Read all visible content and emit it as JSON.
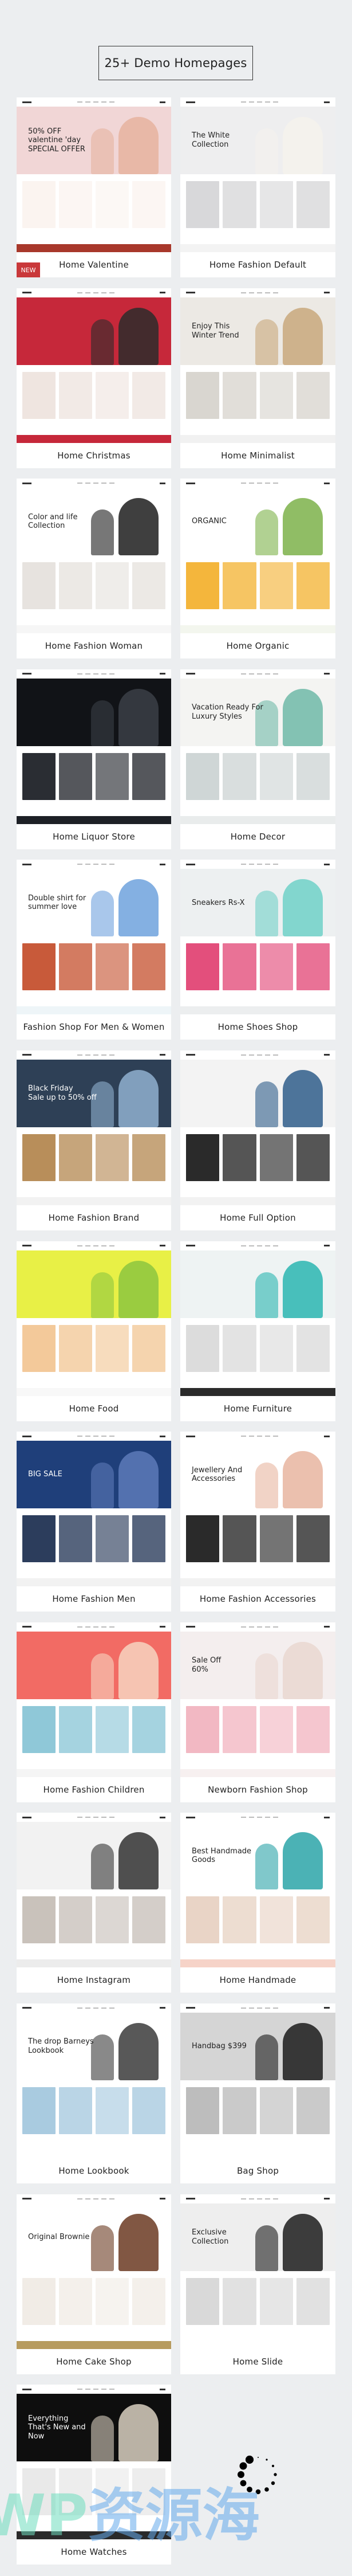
{
  "header": {
    "title": "25+ Demo Homepages"
  },
  "badge_new": "NEW",
  "demos": [
    {
      "label": "Home Valentine",
      "new": true,
      "hero": "50% OFF\nvalentine 'day\nSPECIAL OFFER",
      "bg": "#f1d6d6",
      "fig": "#e6b39f",
      "prod": "#fbf4f0",
      "strip": "#a8382b"
    },
    {
      "label": "Home Fashion Default",
      "hero": "The White\nCollection",
      "bg": "#eeeeef",
      "fig": "#f5f2ec",
      "prod": "#d8d8da",
      "strip": "#f3f3f3"
    },
    {
      "label": "Home Christmas",
      "hero": "",
      "bg": "#c6283a",
      "fig": "#2b2b2b",
      "prod": "#efe5e0",
      "strip": "#c6283a"
    },
    {
      "label": "Home Minimalist",
      "hero": "Enjoy This\nWinter Trend",
      "bg": "#ece9e4",
      "fig": "#c9a87c",
      "prod": "#d9d6d0",
      "strip": "#f1f1f1"
    },
    {
      "label": "Home Fashion Woman",
      "hero": "Color and life\nCollection",
      "bg": "#ffffff",
      "fig": "#1d1d1d",
      "prod": "#e7e3df",
      "strip": "#f6f6f6"
    },
    {
      "label": "Home Organic",
      "hero": "ORGANIC",
      "bg": "#ffffff",
      "fig": "#7db24a",
      "prod": "#f4b63c",
      "strip": "#f3f6ee"
    },
    {
      "label": "Home Liquor Store",
      "hero": "",
      "bg": "#111317",
      "fig": "#3b3f46",
      "prod": "#2a2d33",
      "strip": "#1d2026"
    },
    {
      "label": "Home Decor",
      "hero": "Vacation Ready For\nLuxury Styles",
      "bg": "#f4f4f2",
      "fig": "#6fb9a8",
      "prod": "#cfd6d6",
      "strip": "#e9ecec"
    },
    {
      "label": "Fashion Shop For Men & Women",
      "hero": "Double shirt for\nsummer love",
      "bg": "#ffffff",
      "fig": "#6fa2dd",
      "prod": "#c85a3a",
      "strip": "#eef5f8"
    },
    {
      "label": "Home Shoes Shop",
      "hero": "Sneakers Rs-X",
      "bg": "#edf0f1",
      "fig": "#6fd1c8",
      "prod": "#e34f7c",
      "strip": "#eceeef"
    },
    {
      "label": "Home Fashion Brand",
      "hero": "Black Friday\nSale up to 50% off",
      "bg": "#2e4056",
      "fig": "#8fb0cf",
      "prod": "#b88e5a",
      "strip": "#f2f2f2"
    },
    {
      "label": "Home Full Option",
      "hero": "",
      "bg": "#f3f3f3",
      "fig": "#2f5d8a",
      "prod": "#2a2a2a",
      "strip": "#f2f2f2"
    },
    {
      "label": "Home Food",
      "hero": "",
      "bg": "#e8f046",
      "fig": "#8cc63f",
      "prod": "#f3c99a",
      "strip": "#f8f8f8"
    },
    {
      "label": "Home Furniture",
      "hero": "",
      "bg": "#eef3f3",
      "fig": "#2ab5b0",
      "prod": "#dcdcdc",
      "strip": "#2b2b2b"
    },
    {
      "label": "Home Fashion Men",
      "hero": "BIG SALE",
      "bg": "#1f3f7a",
      "fig": "#5d7ab8",
      "prod": "#2c3d5c",
      "strip": "#f2f2f2"
    },
    {
      "label": "Home Fashion Accessories",
      "hero": "Jewellery And\nAccessories",
      "bg": "#ffffff",
      "fig": "#e8b5a0",
      "prod": "#2a2a2a",
      "strip": "#f2f2f2"
    },
    {
      "label": "Home Fashion Children",
      "hero": "",
      "bg": "#f26b64",
      "fig": "#f7d4c0",
      "prod": "#8fc8d8",
      "strip": "#f5f5f5"
    },
    {
      "label": "Newborn  Fashion  Shop",
      "hero": "Sale Off\n60%",
      "bg": "#f4eeee",
      "fig": "#e9d7d0",
      "prod": "#f2b8c3",
      "strip": "#f7f0f0"
    },
    {
      "label": "Home Instagram",
      "hero": "",
      "bg": "#f2f2f2",
      "fig": "#333333",
      "prod": "#c9c2bb",
      "strip": "#ececec"
    },
    {
      "label": "Home Handmade",
      "hero": "Best Handmade\nGoods",
      "bg": "#ffffff",
      "fig": "#2ca4a8",
      "prod": "#e9d4c6",
      "strip": "#f6d3c8"
    },
    {
      "label": "Home Lookbook",
      "hero": "The drop Barneys\nLookbook",
      "bg": "#ffffff",
      "fig": "#3b3b3b",
      "prod": "#a9cbe0",
      "strip": "#ffffff"
    },
    {
      "label": "Bag Shop",
      "hero": "Handbag $399",
      "bg": "#d5d5d5",
      "fig": "#1b1b1b",
      "prod": "#bdbdbd",
      "strip": "#ffffff"
    },
    {
      "label": "Home Cake Shop",
      "hero": "Original Brownie",
      "bg": "#ffffff",
      "fig": "#6b3a22",
      "prod": "#f1ece6",
      "strip": "#b79b5e"
    },
    {
      "label": "Home Slide",
      "hero": "Exclusive\nCollection",
      "bg": "#eeeeee",
      "fig": "#1c1c1c",
      "prod": "#d9d9d9",
      "strip": "#ffffff"
    },
    {
      "label": "Home Watches",
      "hero": "Everything\nThat's New and Now",
      "bg": "#0e0e0e",
      "fig": "#d8cfbf",
      "prod": "#e9e9e9",
      "strip": "#2a2a2a"
    }
  ],
  "watermark": {
    "latin": "WP",
    "cjk": "资源海"
  },
  "colors": {
    "page_bg": "#eceef0",
    "new_badge": "#c9383a",
    "text": "#222222"
  }
}
